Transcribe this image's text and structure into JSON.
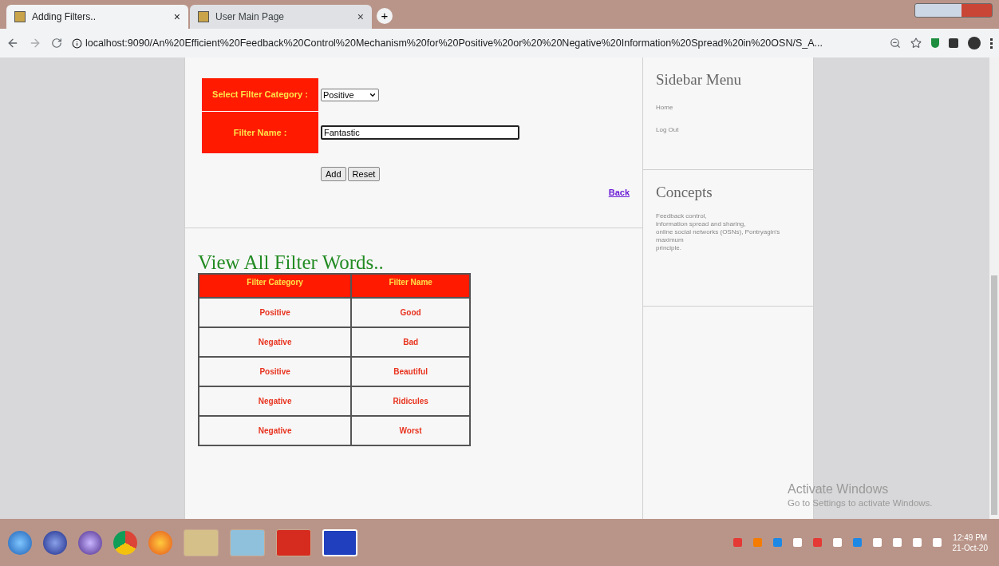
{
  "browser": {
    "tabs": [
      {
        "title": "Adding Filters..",
        "close": "×",
        "selected": true
      },
      {
        "title": "User Main Page",
        "close": "×",
        "selected": false
      }
    ],
    "new_tab": "+",
    "url": "localhost:9090/An%20Efficient%20Feedback%20Control%20Mechanism%20for%20Positive%20or%20%20Negative%20Information%20Spread%20in%20OSN/S_A..."
  },
  "form": {
    "category_label": "Select Filter Category :",
    "category_value": "Positive",
    "name_label": "Filter Name :",
    "name_value": "Fantastic",
    "buttons": [
      "Add",
      "Reset"
    ],
    "back_link": "Back"
  },
  "list": {
    "heading": "View All Filter Words..",
    "columns": [
      "Filter Category",
      "Filter Name"
    ],
    "rows": [
      [
        "Positive",
        "Good"
      ],
      [
        "Negative",
        "Bad"
      ],
      [
        "Positive",
        "Beautiful"
      ],
      [
        "Negative",
        "Ridicules"
      ],
      [
        "Negative",
        "Worst"
      ]
    ]
  },
  "sidebar": {
    "menu_title": "Sidebar Menu",
    "menu_items": [
      "Home",
      "Log Out"
    ],
    "concepts_title": "Concepts",
    "concepts_lines": [
      "Feedback control,",
      "information spread and sharing,",
      "online social networks (OSNs), Pontryagin's",
      "maximum",
      "principle."
    ]
  },
  "activation": {
    "title": "Activate Windows",
    "subtitle": "Go to Settings to activate Windows."
  },
  "taskbar": {
    "time": "12:49 PM",
    "date": "21-Oct-20"
  }
}
